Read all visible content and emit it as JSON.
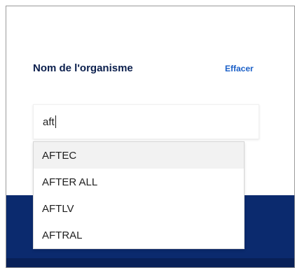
{
  "form": {
    "field_label": "Nom de l'organisme",
    "clear_label": "Effacer",
    "search_value": "aft"
  },
  "dropdown": {
    "options": [
      {
        "label": "AFTEC",
        "highlighted": true
      },
      {
        "label": "AFTER ALL",
        "highlighted": false
      },
      {
        "label": "AFTLV",
        "highlighted": false
      },
      {
        "label": "AFTRAL",
        "highlighted": false
      }
    ]
  },
  "colors": {
    "label": "#0b1f4d",
    "link": "#1a5fc7",
    "dark_band": "#0b2a6e",
    "highlight_bg": "#f2f2f2"
  }
}
